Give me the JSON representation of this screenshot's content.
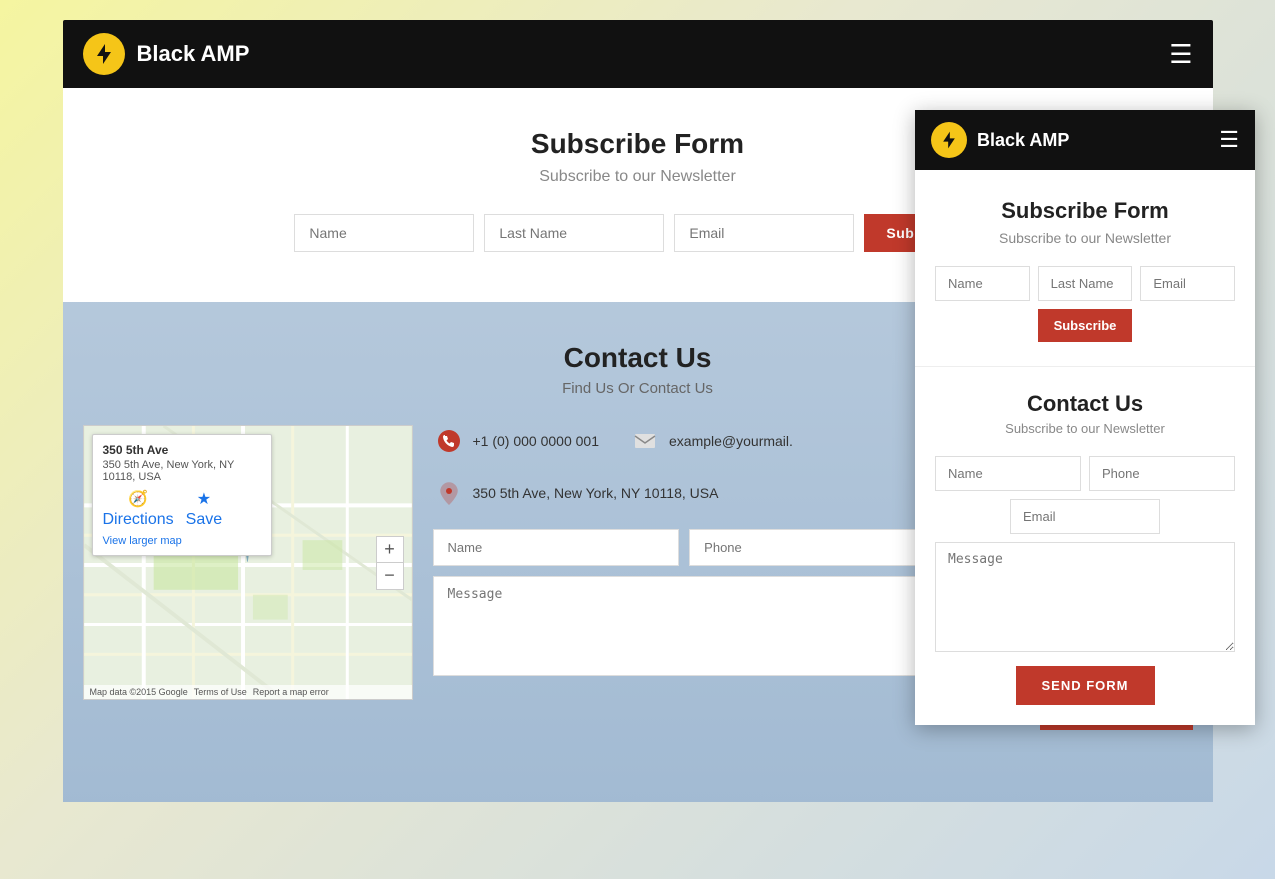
{
  "app": {
    "brand": "Black AMP",
    "brand_icon_alt": "lightning-bolt"
  },
  "navbar": {
    "brand_label": "Black AMP",
    "hamburger_label": "☰"
  },
  "subscribe_section": {
    "title": "Subscribe Form",
    "subtitle": "Subscribe to our Newsletter",
    "name_placeholder": "Name",
    "last_name_placeholder": "Last Name",
    "email_placeholder": "Email",
    "button_label": "Subscribe"
  },
  "contact_section": {
    "title": "Contact Us",
    "subtitle": "Find Us Or Contact Us",
    "phone": "+1 (0) 000 0000 001",
    "email": "example@yourmail.",
    "address": "350 5th Ave, New York, NY 10118, USA",
    "form": {
      "name_placeholder": "Name",
      "phone_placeholder": "Phone",
      "email_placeholder": "Email",
      "message_placeholder": "Message",
      "send_button": "SEND FORM"
    }
  },
  "map": {
    "popup_title": "350 5th Ave",
    "popup_address": "350 5th Ave, New York, NY 10118, USA",
    "directions_label": "Directions",
    "save_label": "Save",
    "view_larger_label": "View larger map",
    "zoom_in": "+",
    "zoom_out": "−",
    "footer_text": "Map data ©2015 Google",
    "terms_text": "Terms of Use",
    "report_text": "Report a map error"
  },
  "mobile_view": {
    "navbar": {
      "brand_label": "Black AMP",
      "hamburger_label": "☰"
    },
    "subscribe": {
      "title": "Subscribe Form",
      "subtitle": "Subscribe to our Newsletter",
      "name_placeholder": "Name",
      "last_name_placeholder": "Last Name",
      "email_placeholder": "Email",
      "button_label": "Subscribe"
    },
    "contact": {
      "title": "Contact Us",
      "subtitle": "Subscribe to our Newsletter",
      "name_placeholder": "Name",
      "phone_placeholder": "Phone",
      "email_placeholder": "Email",
      "message_placeholder": "Message",
      "send_button": "SEND FORM"
    }
  }
}
